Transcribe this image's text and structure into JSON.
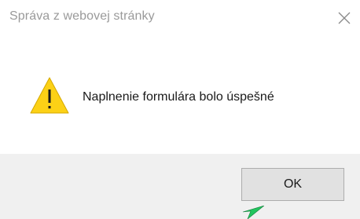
{
  "dialog": {
    "title": "Správa z webovej stránky",
    "message": "Naplnenie formulára bolo úspešné",
    "ok_label": "OK",
    "icon": "warning-triangle-icon",
    "close_icon": "close-icon"
  },
  "colors": {
    "title_text": "#9a9a9a",
    "footer_bg": "#f0f0f0",
    "button_bg": "#e1e1e1",
    "button_border": "#adadad",
    "warning_yellow": "#fcd116",
    "cursor_green": "#22c55e"
  }
}
